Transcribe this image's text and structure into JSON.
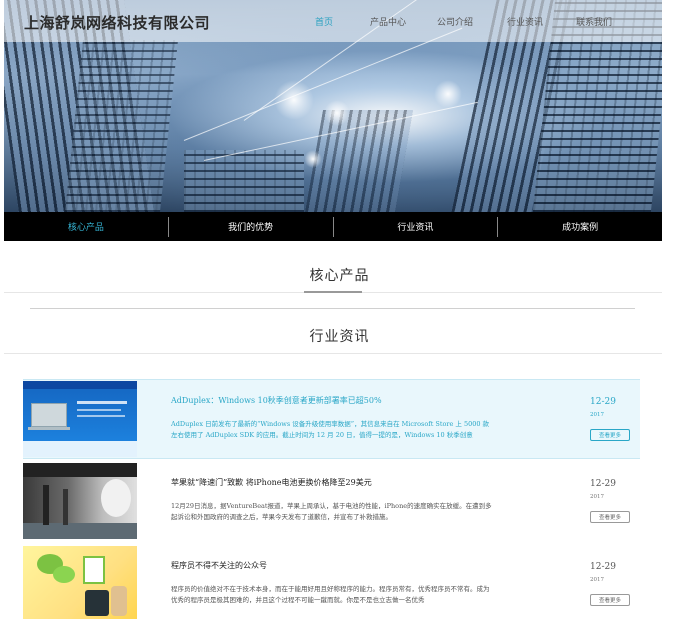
{
  "header": {
    "logo_text": "上海舒岚网络科技有限公司",
    "nav": [
      "首页",
      "产品中心",
      "公司介绍",
      "行业资讯",
      "联系我们"
    ]
  },
  "subnav": [
    "核心产品",
    "我们的优势",
    "行业资讯",
    "成功案例"
  ],
  "sections": {
    "core_products_title": "核心产品",
    "industry_news_title": "行业资讯"
  },
  "news": [
    {
      "title": "AdDuplex：Windows 10秋季创意者更新部署率已超50%",
      "desc": "AdDuplex 日前发布了最新的“Windows 设备升级使用率数据”，其信息来自在 Microsoft Store 上 5000 款左右使用了 AdDuplex SDK 的应用。截止时间为 12 月 20 日，值得一提的是，Windows 10 秋季创意",
      "day": "12-29",
      "year": "2017",
      "more": "查看更多"
    },
    {
      "title": "苹果就“降速门”致歉 将iPhone电池更换价格降至29美元",
      "desc": "12月29日消息，据VentureBeat报道，苹果上周承认，基于电池的性能，iPhone的速度确实在放缓。在遭到多起诉讼和外国政府的调查之后，苹果今天发布了道歉信，并宣布了补救措施。",
      "day": "12-29",
      "year": "2017",
      "more": "查看更多"
    },
    {
      "title": "程序员不得不关注的公众号",
      "desc": "程序员的价值绝对不在于技术本身，而在于能用好用且好称程序的能力。程序员常有，优秀程序员不常有。成为优秀的程序员是极其困难的，并且这个过程不可能一蹴而就。你是不是也立志做一名优秀",
      "day": "12-29",
      "year": "2017",
      "more": "查看更多"
    }
  ]
}
